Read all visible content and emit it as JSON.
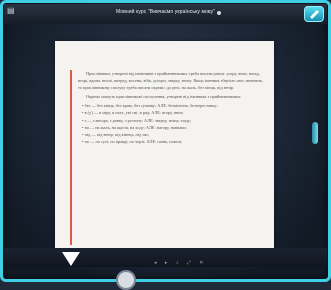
{
  "window": {
    "title": "Мовний курс \"Вивчаємо українську мову\"",
    "menu_icon": "menu-icon",
    "corner_icon": "pen-icon"
  },
  "document": {
    "paragraph1": "Прислівники, утворені від іменників з прийменниками, треба писати разом: угору, вниз, назад, вгорі, вдома, вночі, вперед, восени, вбік, догори, зверху, знизу. Якщо іменник зберігає своє значення, то прислівникову сполуку треба писати окремо: до речі, на жаль, без кінця, під вечір.",
    "paragraph2": "Окремо пишуть прислівникові сполучення, утворені від іменника з прийменниками:",
    "bullets": [
      "• без — без кінця, без краю, без сумніву; АЛЕ: безкінечно, безперестанку;",
      "• в (у) — в міру, в очах, уві сні, в ряд; АЛЕ: вгору, вниз;",
      "• з — з вечора, з ранку, з розгону; АЛЕ: зверху, знизу, ззаду;",
      "• на — на жаль, на щастя, на ходу; АЛЕ: нагору, навпаки;",
      "• під — під вечір, під кінець, під час;",
      "• по — по суті, по правді, по черзі; АЛЕ: повік, поволі;"
    ],
    "accent_color": "#d0392b"
  },
  "bottom": {
    "controls": [
      "◂",
      "▸",
      "♪",
      "⤢",
      "✕"
    ]
  }
}
